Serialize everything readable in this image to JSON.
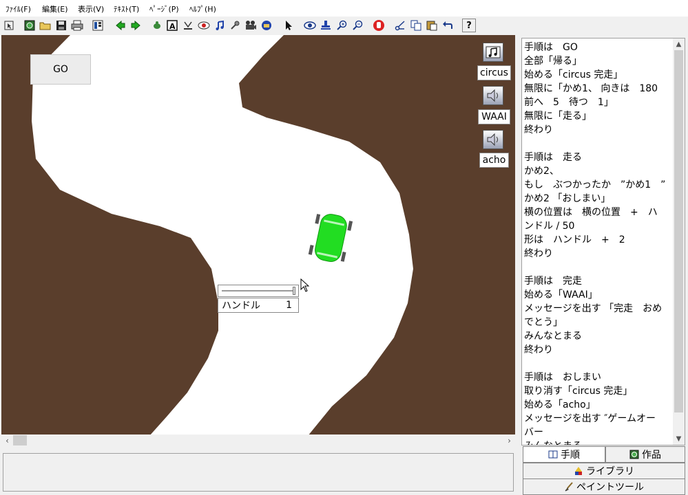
{
  "menu": [
    "ﾌｧｲﾙ(F)",
    "編集(E)",
    "表示(V)",
    "ﾃｷｽﾄ(T)",
    "ﾍﾟｰｼﾞ(P)",
    "ﾍﾙﾌﾟ(H)"
  ],
  "toolbar": {
    "help_glyph": "?"
  },
  "stage": {
    "go_label": "GO",
    "sounds": [
      "circus",
      "WAAI",
      "acho"
    ],
    "handle_label": "ハンドル",
    "handle_value": "1",
    "colors": {
      "ground": "#5a3e2c",
      "road": "#ffffff",
      "car": "#22dd22"
    }
  },
  "script": {
    "lines": [
      "手順は　GO",
      "全部「帰る」",
      "始める「circus 完走」",
      "無限に「かめ1、 向きは　180",
      "前へ　5　待つ　1」",
      "無限に「走る」",
      "終わり",
      "",
      "手順は　走る",
      "かめ2、",
      "もし　ぶつかったか　”かめ1　”",
      "かめ2 「おしまい」",
      "横の位置は　横の位置　+　ハ",
      "ンドル / 50",
      "形は　ハンドル　+　2",
      "終わり",
      "",
      "手順は　完走",
      "始める「WAAI」",
      "メッセージを出す 「完走　おめ",
      "でとう」",
      "みんなとまる",
      "終わり",
      "",
      "手順は　おしまい",
      "取り消す「circus 完走」",
      "始める「acho」",
      "メッセージを出す ″ゲームオー",
      "バー",
      "みんなとまる"
    ]
  },
  "tabs": {
    "procedures": "手順",
    "works": "作品",
    "library": "ライブラリ",
    "paint": "ペイントツール"
  }
}
